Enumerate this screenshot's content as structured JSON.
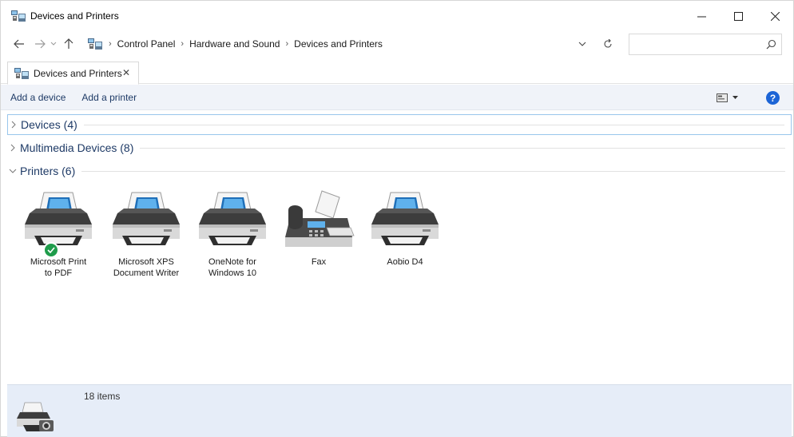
{
  "window": {
    "title": "Devices and Printers",
    "minimize_glyph": "—",
    "maximize_glyph": "☐",
    "close_glyph": "✕"
  },
  "nav": {
    "breadcrumbs": [
      "Control Panel",
      "Hardware and Sound",
      "Devices and Printers"
    ],
    "search_placeholder": ""
  },
  "tab": {
    "label": "Devices and Printers",
    "close_glyph": "✕"
  },
  "commands": {
    "add_device": "Add a device",
    "add_printer": "Add a printer",
    "help": "?"
  },
  "groups": [
    {
      "label": "Devices (4)",
      "expanded": false
    },
    {
      "label": "Multimedia Devices (8)",
      "expanded": false
    },
    {
      "label": "Printers (6)",
      "expanded": true
    }
  ],
  "printers": [
    {
      "label_line1": "Microsoft Print",
      "label_line2": "to PDF",
      "icon": "printer-icon",
      "default": true
    },
    {
      "label_line1": "Microsoft XPS",
      "label_line2": "Document Writer",
      "icon": "printer-icon",
      "default": false
    },
    {
      "label_line1": "OneNote for",
      "label_line2": "Windows 10",
      "icon": "printer-icon",
      "default": false
    },
    {
      "label_line1": "Fax",
      "label_line2": "",
      "icon": "fax-icon",
      "default": false
    },
    {
      "label_line1": "Aobio D4",
      "label_line2": "",
      "icon": "printer-icon",
      "default": false
    }
  ],
  "details": {
    "item_count": "18 items"
  },
  "colors": {
    "accent": "#1c64d6",
    "command_bar": "#f0f3f9",
    "details_pane": "#e6edf8",
    "group_text": "#1e3a66",
    "check_green": "#1f9c4b"
  }
}
